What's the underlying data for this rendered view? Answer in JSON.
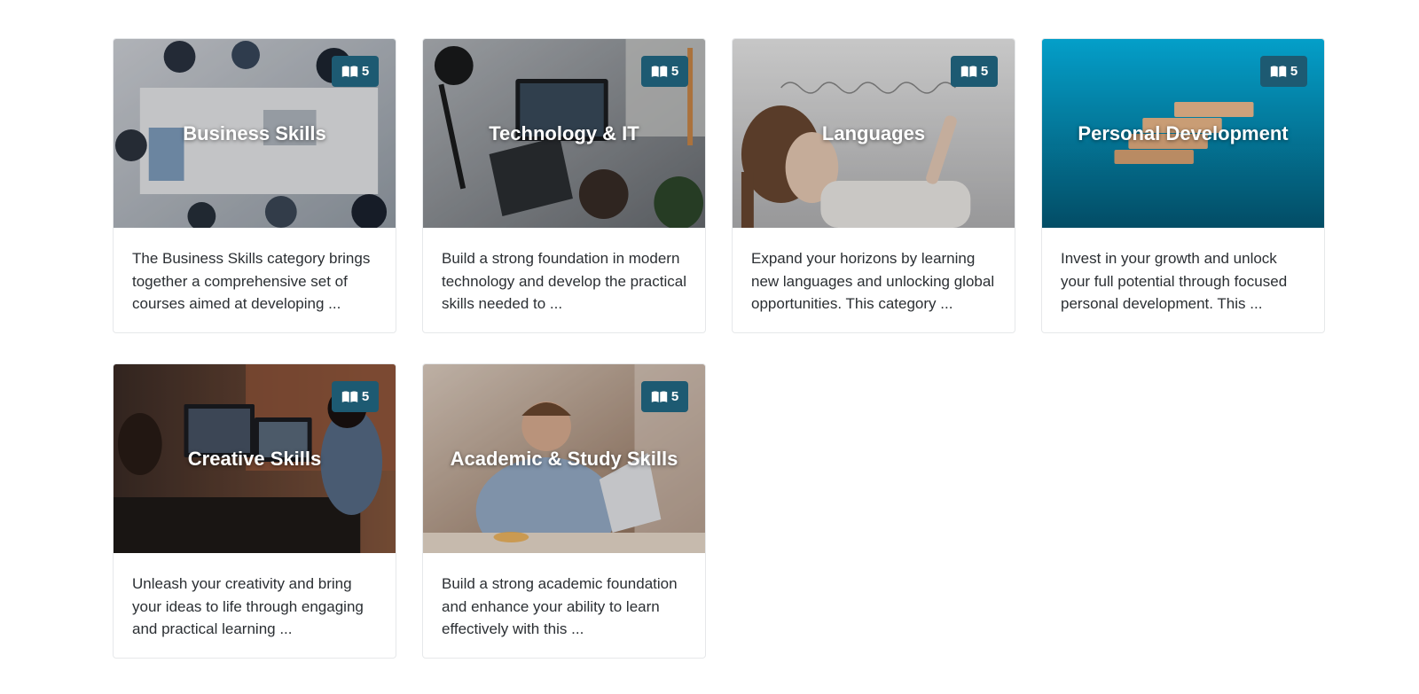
{
  "categories": [
    {
      "title": "Business Skills",
      "count": "5",
      "badge_icon": "book-open-icon",
      "description": "The Business Skills category brings together a comprehensive set of courses aimed at developing ...",
      "theme": {
        "bg": "#c9ccd2",
        "accent": "#3f4b5c"
      }
    },
    {
      "title": "Technology & IT",
      "count": "5",
      "badge_icon": "book-open-icon",
      "description": "Build a strong foundation in modern technology and develop the practical skills needed to ...",
      "theme": {
        "bg": "#8e9297",
        "accent": "#2a2d31"
      }
    },
    {
      "title": "Languages",
      "count": "5",
      "badge_icon": "book-open-icon",
      "description": "Expand your horizons by learning new languages and unlocking global opportunities. This category ...",
      "theme": {
        "bg": "#e9e9ea",
        "accent": "#5b4a3c"
      }
    },
    {
      "title": "Personal Development",
      "count": "5",
      "badge_icon": "book-open-icon",
      "description": "Invest in your growth and unlock your full potential through focused personal development. This ...",
      "theme": {
        "bg": "#0a8fb3",
        "accent": "#c9966c"
      }
    },
    {
      "title": "Creative Skills",
      "count": "5",
      "badge_icon": "book-open-icon",
      "description": "Unleash your creativity and bring your ideas to life through engaging and practical learning ...",
      "theme": {
        "bg": "#5a4236",
        "accent": "#3a2c25"
      }
    },
    {
      "title": "Academic & Study Skills",
      "count": "5",
      "badge_icon": "book-open-icon",
      "description": "Build a strong academic foundation and enhance your ability to learn effectively with this ...",
      "theme": {
        "bg": "#b9a08d",
        "accent": "#7b5c47"
      }
    }
  ],
  "colors": {
    "badge_bg": "#1d5a72",
    "card_border": "#e6e8ea",
    "text": "#2b2f33"
  }
}
